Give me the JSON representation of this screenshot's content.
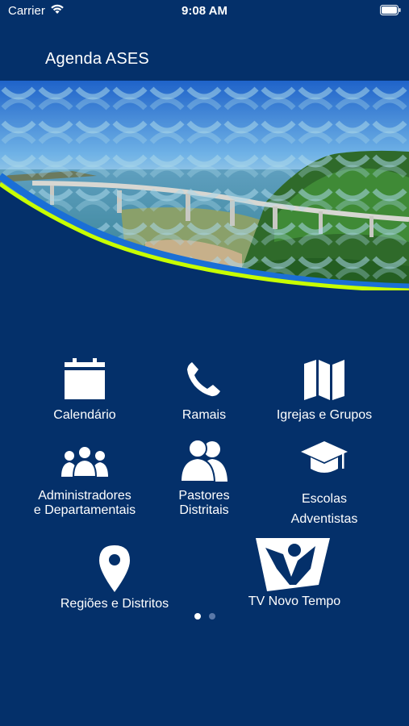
{
  "status_bar": {
    "carrier": "Carrier",
    "time": "9:08 AM"
  },
  "header": {
    "title": "Agenda ASES"
  },
  "menu": {
    "calendario": "Calendário",
    "ramais": "Ramais",
    "igrejas": "Igrejas e Grupos",
    "admin_line1": "Administradores",
    "admin_line2": "e Departamentais",
    "pastores_line1": "Pastores",
    "pastores_line2": "Distritais",
    "escolas_line1": "Escolas",
    "escolas_line2": "Adventistas",
    "regioes": "Regiões e Distritos",
    "tv": "TV Novo Tempo"
  },
  "pager": {
    "pages": 2,
    "current": 1
  },
  "colors": {
    "background": "#04306a",
    "accent_green": "#c8ff00",
    "accent_blue": "#1a6fd6"
  }
}
